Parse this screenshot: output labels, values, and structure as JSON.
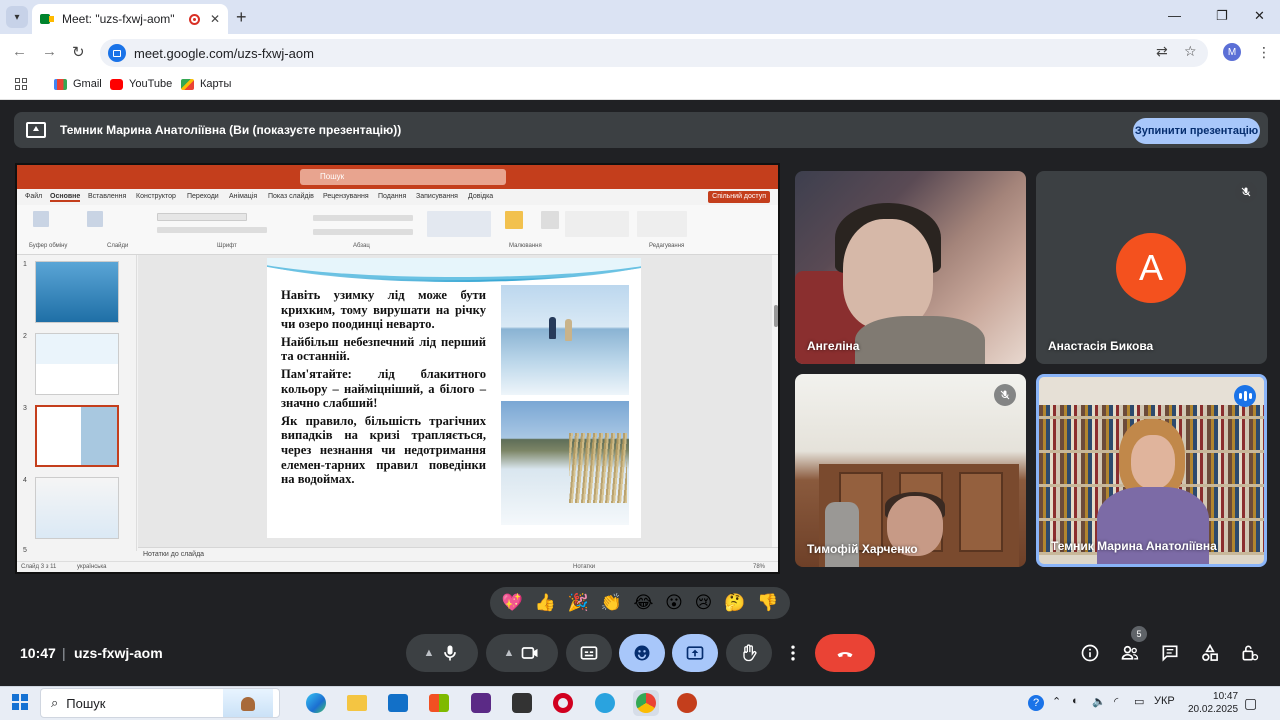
{
  "browser": {
    "tab_title": "Meet: \"uzs-fxwj-aom\"",
    "url": "meet.google.com/uzs-fxwj-aom",
    "profile_letter": "M",
    "bookmarks": [
      "Gmail",
      "YouTube",
      "Карты"
    ]
  },
  "meet": {
    "presenting_banner": "Темник Марина Анатоліївна (Ви (показуєте презентацію))",
    "stop_button": "Зупинити презентацію",
    "time": "10:47",
    "meeting_code": "uzs-fxwj-aom",
    "participant_count": "5",
    "participants": [
      {
        "name": "Ангеліна",
        "muted": false
      },
      {
        "name": "Анастасія Бикова",
        "muted": true,
        "avatar_letter": "A",
        "avatar_color": "#f4511e"
      },
      {
        "name": "Тимофій Харченко",
        "muted": true
      },
      {
        "name": "Темник Марина Анатоліївна",
        "speaking": true
      }
    ],
    "reactions": [
      "💖",
      "👍",
      "🎉",
      "👏",
      "😂",
      "😮",
      "😢",
      "🤔",
      "👎"
    ]
  },
  "powerpoint": {
    "search": "Пошук",
    "ribbon_tabs": [
      "Файл",
      "Основне",
      "Вставлення",
      "Конструктор",
      "Переходи",
      "Анімація",
      "Показ слайдів",
      "Рецензування",
      "Подання",
      "Записування",
      "Довідка"
    ],
    "share_button": "Спільний доступ",
    "groups": [
      "Буфер обміну",
      "Слайди",
      "Шрифт",
      "Абзац",
      "Малювання",
      "Редагування"
    ],
    "notes": "Нотатки до слайда",
    "status_slide": "Слайд 3 з 11",
    "status_lang": "українська",
    "status_notes": "Нотатки",
    "zoom": "78%",
    "slide_paragraphs": [
      "Навіть узимку лід може бути крихким, тому вирушати на річку чи озеро поодинці невартo.",
      "Найбільш небезпечний лід перший та останній.",
      "Пам'ятайте: лід блакитного кольору – найміцніший, а білого – значно слабший!",
      "Як правило, більшість трагічних випадків на кризі трапляється, через незнання чи недотримання елемен-тарних правил поведінки на водоймах."
    ]
  },
  "taskbar": {
    "search": "Пошук",
    "lang": "УКР",
    "time": "10:47",
    "date": "20.02.2025"
  }
}
